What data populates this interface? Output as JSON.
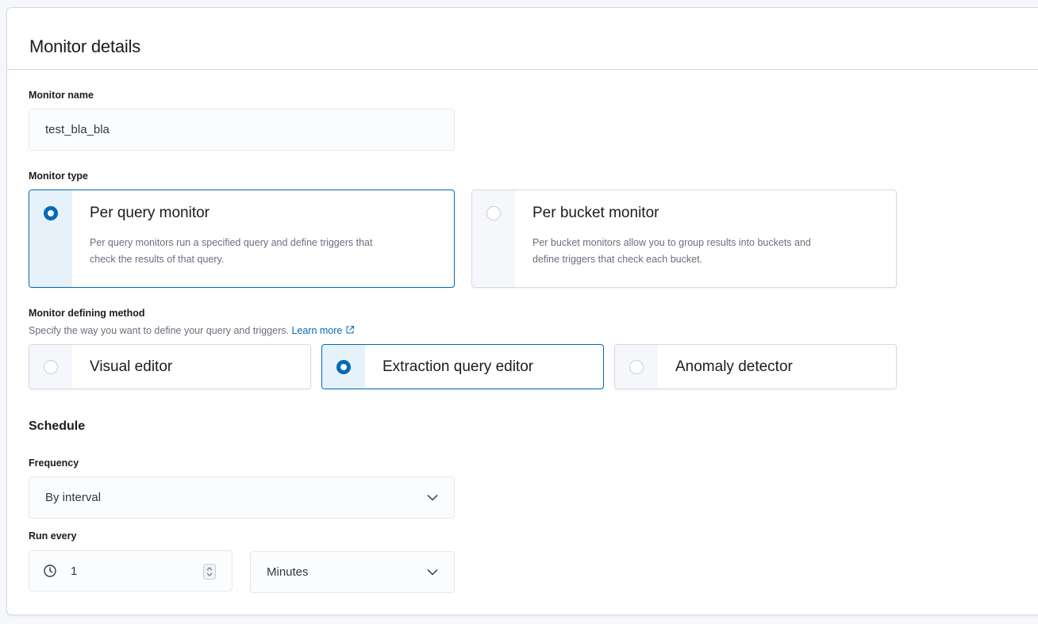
{
  "panel": {
    "title": "Monitor details"
  },
  "monitor_name": {
    "label": "Monitor name",
    "value": "test_bla_bla"
  },
  "monitor_type": {
    "label": "Monitor type",
    "options": [
      {
        "title": "Per query monitor",
        "desc_line1": "Per query monitors run a specified query and define triggers that",
        "desc_line2": "check the results of that query.",
        "selected": true
      },
      {
        "title": "Per bucket monitor",
        "desc_line1": "Per bucket monitors allow you to group results into buckets and",
        "desc_line2": "define triggers that check each bucket.",
        "selected": false
      }
    ]
  },
  "defining_method": {
    "label": "Monitor defining method",
    "help": "Specify the way you want to define your query and triggers.",
    "learn_more": "Learn more",
    "options": [
      {
        "label": "Visual editor",
        "selected": false
      },
      {
        "label": "Extraction query editor",
        "selected": true
      },
      {
        "label": "Anomaly detector",
        "selected": false
      }
    ]
  },
  "schedule": {
    "title": "Schedule",
    "frequency_label": "Frequency",
    "frequency_value": "By interval",
    "run_every_label": "Run every",
    "interval_value": "1",
    "unit_value": "Minutes"
  },
  "colors": {
    "accent": "#006bb8",
    "border": "#d3dae6",
    "muted_text": "#69707d"
  },
  "icons": {
    "external_link": "external-link-icon",
    "clock": "clock-icon",
    "chevron": "chevron-down-icon",
    "stepper": "stepper-icon"
  }
}
